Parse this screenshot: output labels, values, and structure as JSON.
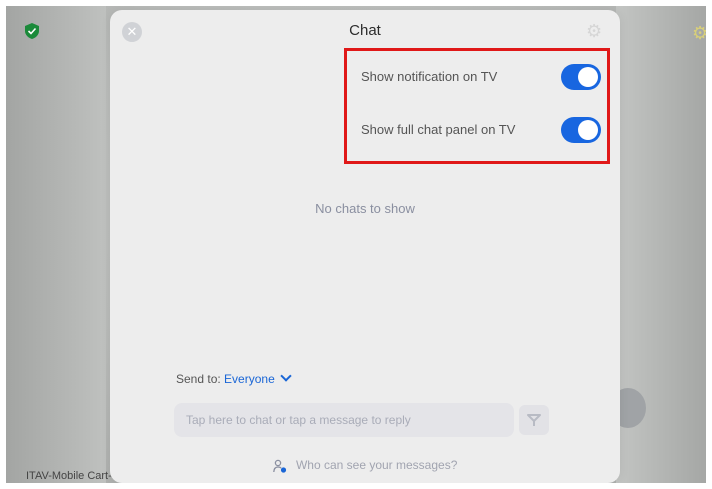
{
  "background": {
    "device_label": "ITAV-Mobile Cart-"
  },
  "chat_panel": {
    "title": "Chat",
    "settings": [
      {
        "label": "Show notification on TV",
        "enabled": true
      },
      {
        "label": "Show full chat panel on TV",
        "enabled": true
      }
    ],
    "empty_message": "No chats to show",
    "send_to": {
      "label": "Send to:",
      "value": "Everyone"
    },
    "input": {
      "value": "",
      "placeholder": "Tap here to chat or tap a message to reply"
    },
    "footer_link": "Who can see your messages?"
  },
  "colors": {
    "toggle_on": "#1866e0",
    "highlight_box": "#e01818",
    "link_blue": "#1a66d6",
    "shield_green": "#1b8a3a"
  },
  "icons": [
    "shield-check-icon",
    "gear-icon",
    "close-icon",
    "chevron-down-icon",
    "send-icon",
    "person-icon"
  ]
}
